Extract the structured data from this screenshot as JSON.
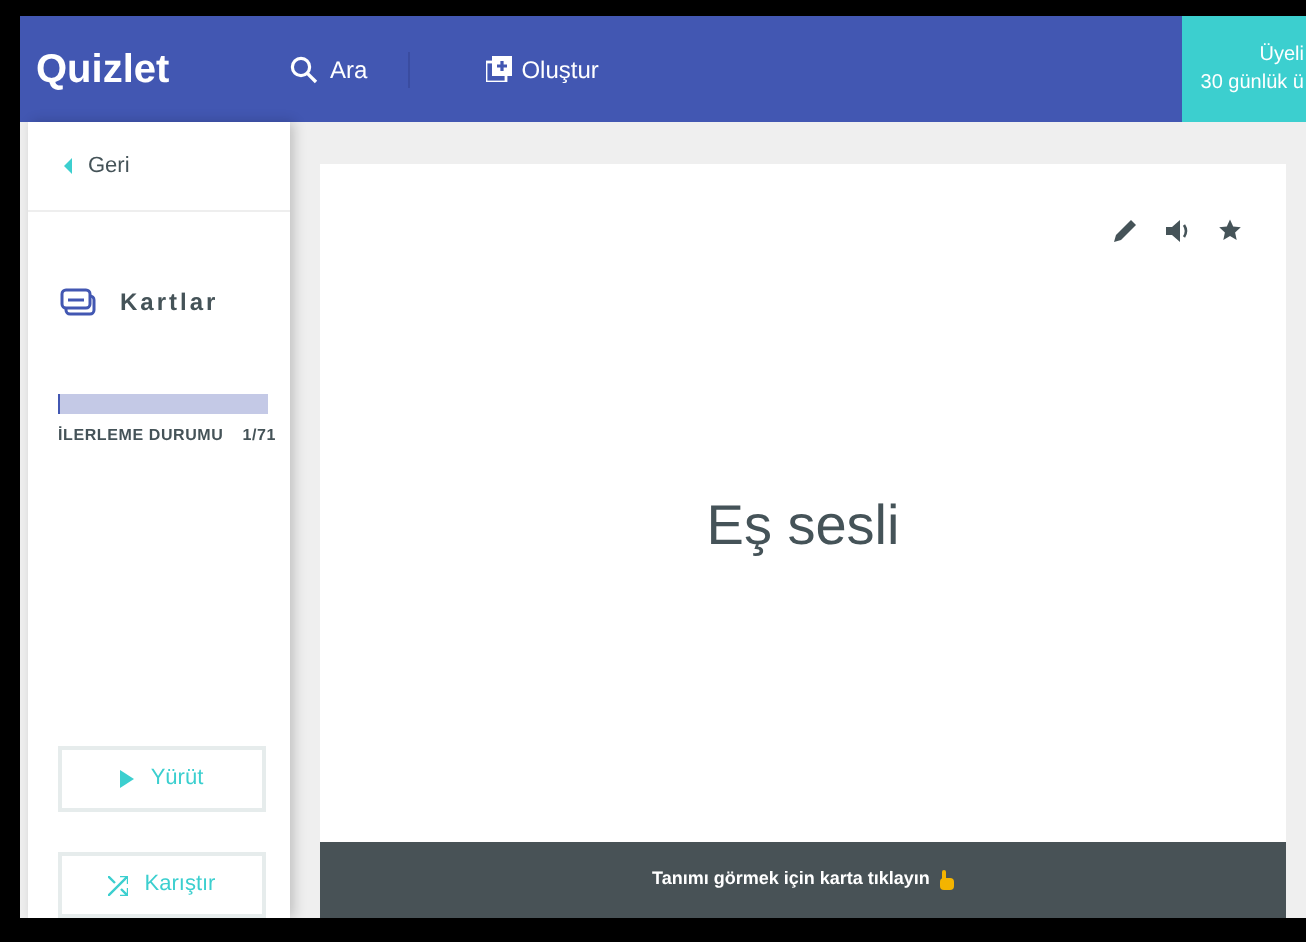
{
  "header": {
    "logo": "Quizlet",
    "search": "Ara",
    "create": "Oluştur",
    "promo": [
      "Üyeli",
      "30 günlük ü"
    ]
  },
  "sidebar": {
    "back": "Geri",
    "mode": "Kartlar",
    "progress": {
      "label": "İLERLEME DURUMU",
      "count": "1/71",
      "level": 0.014
    },
    "buttons": [
      {
        "kind": "play",
        "label": "Yürüt"
      },
      {
        "kind": "shuffle",
        "label": "Karıştır"
      }
    ]
  },
  "card": {
    "term": "Eş sesli",
    "hint": "Tanımı görmek için karta tıklayın"
  }
}
